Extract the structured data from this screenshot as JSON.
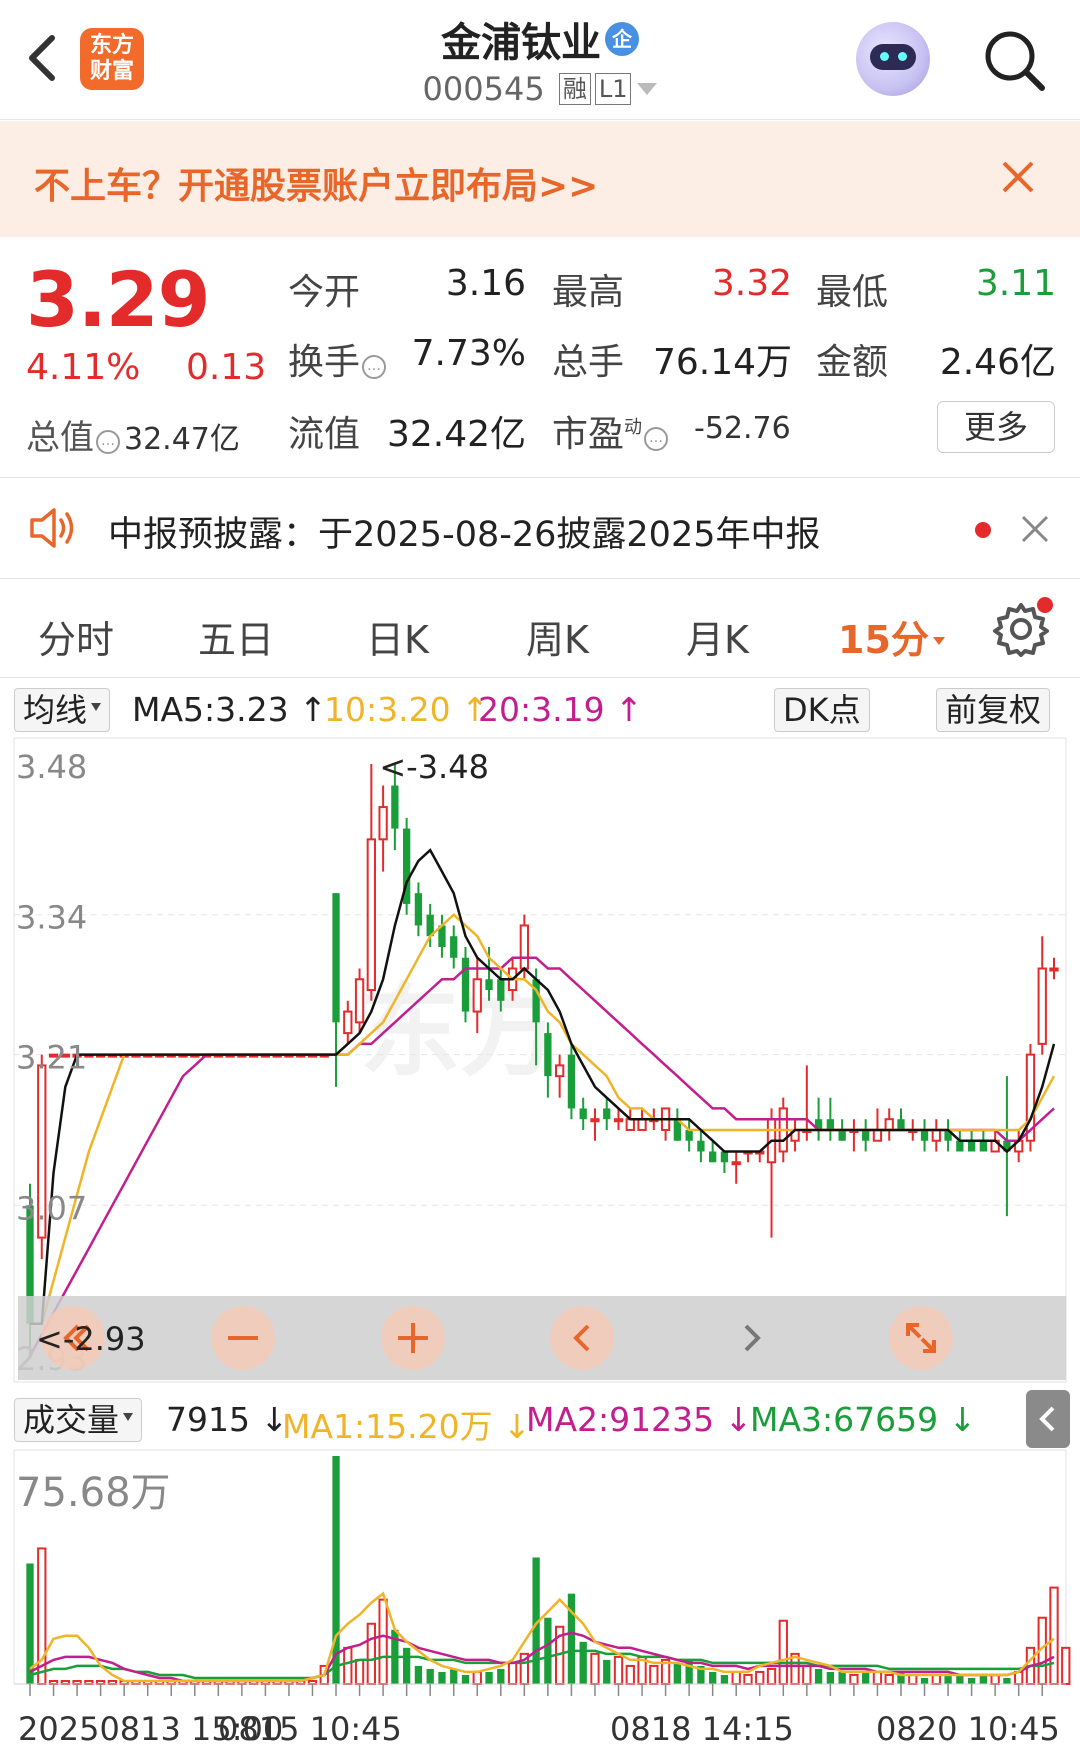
{
  "header": {
    "title": "金浦钛业",
    "qi_badge": "企",
    "code": "000545",
    "tag_rong": "融",
    "tag_level": "L1",
    "logo_text_line1": "东方",
    "logo_text_line2": "财富"
  },
  "banner": {
    "text": "不上车？开通股票账户立即布局>>"
  },
  "quote": {
    "price": "3.29",
    "change_pct": "4.11%",
    "change": "0.13",
    "total_value_label": "总值",
    "total_value": "32.47亿",
    "open_label": "今开",
    "open": "3.16",
    "high_label": "最高",
    "high": "3.32",
    "low_label": "最低",
    "low": "3.11",
    "turnover_label": "换手",
    "turnover": "7.73%",
    "volume_label": "总手",
    "volume": "76.14万",
    "amount_label": "金额",
    "amount": "2.46亿",
    "float_label": "流值",
    "float_value": "32.42亿",
    "pe_label": "市盈",
    "pe_sup": "动",
    "pe": "-52.76",
    "more_button": "更多"
  },
  "notice": {
    "text": "中报预披露：于2025-08-26披露2025年中报"
  },
  "tabs": {
    "items": [
      "分时",
      "五日",
      "日K",
      "周K",
      "月K",
      "15分"
    ],
    "active_index": 5
  },
  "ma_row": {
    "selector": "均线",
    "ma5": "MA5:3.23 ↑",
    "ma10": "10:3.20 ↑",
    "ma20": "20:3.19 ↑",
    "dk_button": "DK点",
    "fq_button": "前复权"
  },
  "vol_row": {
    "selector": "成交量",
    "vol": "7915 ↓",
    "ma1": "MA1:15.20万 ↓",
    "ma2": "MA2:91235 ↓",
    "ma3": "MA3:67659 ↓"
  },
  "colors": {
    "up": "#e42b2b",
    "down": "#1a9e3a",
    "accent": "#e8662a",
    "ma5": "#111111",
    "ma10": "#f0b429",
    "ma20": "#c21e8e"
  },
  "chart_data": [
    {
      "type": "candlestick",
      "y_ticks": [
        "3.48",
        "3.34",
        "3.21",
        "3.07",
        "2.93"
      ],
      "ylim": [
        2.93,
        3.48
      ],
      "max_marker": "<-3.48",
      "min_marker": "<-2.93",
      "x_labels": [
        "20250813 15:00",
        "0815 10:45",
        "0818 14:15",
        "0820 10:45"
      ],
      "candles": [
        {
          "o": 3.07,
          "c": 2.96,
          "h": 3.09,
          "l": 2.93
        },
        {
          "o": 3.04,
          "c": 3.2,
          "h": 3.21,
          "l": 3.02
        },
        {
          "o": 3.21,
          "c": 3.21,
          "h": 3.21,
          "l": 3.21
        },
        {
          "o": 3.21,
          "c": 3.21,
          "h": 3.21,
          "l": 3.21
        },
        {
          "o": 3.21,
          "c": 3.21,
          "h": 3.21,
          "l": 3.21
        },
        {
          "o": 3.21,
          "c": 3.21,
          "h": 3.21,
          "l": 3.21
        },
        {
          "o": 3.21,
          "c": 3.21,
          "h": 3.21,
          "l": 3.21
        },
        {
          "o": 3.21,
          "c": 3.21,
          "h": 3.21,
          "l": 3.21
        },
        {
          "o": 3.21,
          "c": 3.21,
          "h": 3.21,
          "l": 3.21
        },
        {
          "o": 3.21,
          "c": 3.21,
          "h": 3.21,
          "l": 3.21
        },
        {
          "o": 3.21,
          "c": 3.21,
          "h": 3.21,
          "l": 3.21
        },
        {
          "o": 3.21,
          "c": 3.21,
          "h": 3.21,
          "l": 3.21
        },
        {
          "o": 3.21,
          "c": 3.21,
          "h": 3.21,
          "l": 3.21
        },
        {
          "o": 3.21,
          "c": 3.21,
          "h": 3.21,
          "l": 3.21
        },
        {
          "o": 3.21,
          "c": 3.21,
          "h": 3.21,
          "l": 3.21
        },
        {
          "o": 3.21,
          "c": 3.21,
          "h": 3.21,
          "l": 3.21
        },
        {
          "o": 3.21,
          "c": 3.21,
          "h": 3.21,
          "l": 3.21
        },
        {
          "o": 3.21,
          "c": 3.21,
          "h": 3.21,
          "l": 3.21
        },
        {
          "o": 3.21,
          "c": 3.21,
          "h": 3.21,
          "l": 3.21
        },
        {
          "o": 3.21,
          "c": 3.21,
          "h": 3.21,
          "l": 3.21
        },
        {
          "o": 3.21,
          "c": 3.21,
          "h": 3.21,
          "l": 3.21
        },
        {
          "o": 3.21,
          "c": 3.21,
          "h": 3.21,
          "l": 3.21
        },
        {
          "o": 3.21,
          "c": 3.21,
          "h": 3.21,
          "l": 3.21
        },
        {
          "o": 3.21,
          "c": 3.21,
          "h": 3.21,
          "l": 3.21
        },
        {
          "o": 3.21,
          "c": 3.21,
          "h": 3.21,
          "l": 3.21
        },
        {
          "o": 3.21,
          "c": 3.21,
          "h": 3.21,
          "l": 3.21
        },
        {
          "o": 3.36,
          "c": 3.24,
          "h": 3.36,
          "l": 3.18
        },
        {
          "o": 3.23,
          "c": 3.25,
          "h": 3.26,
          "l": 3.22
        },
        {
          "o": 3.24,
          "c": 3.28,
          "h": 3.29,
          "l": 3.23
        },
        {
          "o": 3.27,
          "c": 3.41,
          "h": 3.48,
          "l": 3.26
        },
        {
          "o": 3.41,
          "c": 3.44,
          "h": 3.46,
          "l": 3.38
        },
        {
          "o": 3.46,
          "c": 3.42,
          "h": 3.48,
          "l": 3.4
        },
        {
          "o": 3.42,
          "c": 3.35,
          "h": 3.43,
          "l": 3.34
        },
        {
          "o": 3.36,
          "c": 3.33,
          "h": 3.37,
          "l": 3.32
        },
        {
          "o": 3.34,
          "c": 3.32,
          "h": 3.35,
          "l": 3.31
        },
        {
          "o": 3.33,
          "c": 3.31,
          "h": 3.34,
          "l": 3.3
        },
        {
          "o": 3.32,
          "c": 3.3,
          "h": 3.33,
          "l": 3.29
        },
        {
          "o": 3.3,
          "c": 3.25,
          "h": 3.31,
          "l": 3.24
        },
        {
          "o": 3.25,
          "c": 3.28,
          "h": 3.3,
          "l": 3.23
        },
        {
          "o": 3.28,
          "c": 3.27,
          "h": 3.31,
          "l": 3.26
        },
        {
          "o": 3.28,
          "c": 3.26,
          "h": 3.29,
          "l": 3.25
        },
        {
          "o": 3.27,
          "c": 3.29,
          "h": 3.3,
          "l": 3.26
        },
        {
          "o": 3.29,
          "c": 3.33,
          "h": 3.34,
          "l": 3.28
        },
        {
          "o": 3.28,
          "c": 3.24,
          "h": 3.29,
          "l": 3.2
        },
        {
          "o": 3.23,
          "c": 3.19,
          "h": 3.24,
          "l": 3.17
        },
        {
          "o": 3.19,
          "c": 3.2,
          "h": 3.21,
          "l": 3.17
        },
        {
          "o": 3.21,
          "c": 3.16,
          "h": 3.22,
          "l": 3.15
        },
        {
          "o": 3.16,
          "c": 3.15,
          "h": 3.17,
          "l": 3.14
        },
        {
          "o": 3.15,
          "c": 3.15,
          "h": 3.16,
          "l": 3.13
        },
        {
          "o": 3.16,
          "c": 3.15,
          "h": 3.17,
          "l": 3.14
        },
        {
          "o": 3.15,
          "c": 3.15,
          "h": 3.16,
          "l": 3.14
        },
        {
          "o": 3.14,
          "c": 3.15,
          "h": 3.16,
          "l": 3.14
        },
        {
          "o": 3.14,
          "c": 3.15,
          "h": 3.16,
          "l": 3.14
        },
        {
          "o": 3.15,
          "c": 3.15,
          "h": 3.16,
          "l": 3.14
        },
        {
          "o": 3.14,
          "c": 3.16,
          "h": 3.16,
          "l": 3.13
        },
        {
          "o": 3.15,
          "c": 3.13,
          "h": 3.16,
          "l": 3.13
        },
        {
          "o": 3.14,
          "c": 3.13,
          "h": 3.15,
          "l": 3.12
        },
        {
          "o": 3.13,
          "c": 3.12,
          "h": 3.14,
          "l": 3.11
        },
        {
          "o": 3.12,
          "c": 3.11,
          "h": 3.13,
          "l": 3.11
        },
        {
          "o": 3.12,
          "c": 3.11,
          "h": 3.12,
          "l": 3.1
        },
        {
          "o": 3.11,
          "c": 3.11,
          "h": 3.12,
          "l": 3.09
        },
        {
          "o": 3.12,
          "c": 3.12,
          "h": 3.12,
          "l": 3.11
        },
        {
          "o": 3.12,
          "c": 3.12,
          "h": 3.12,
          "l": 3.11
        },
        {
          "o": 3.11,
          "c": 3.15,
          "h": 3.16,
          "l": 3.04
        },
        {
          "o": 3.12,
          "c": 3.16,
          "h": 3.17,
          "l": 3.11
        },
        {
          "o": 3.13,
          "c": 3.14,
          "h": 3.15,
          "l": 3.12
        },
        {
          "o": 3.14,
          "c": 3.14,
          "h": 3.2,
          "l": 3.13
        },
        {
          "o": 3.15,
          "c": 3.14,
          "h": 3.17,
          "l": 3.13
        },
        {
          "o": 3.15,
          "c": 3.14,
          "h": 3.17,
          "l": 3.13
        },
        {
          "o": 3.14,
          "c": 3.13,
          "h": 3.15,
          "l": 3.13
        },
        {
          "o": 3.14,
          "c": 3.14,
          "h": 3.15,
          "l": 3.12
        },
        {
          "o": 3.14,
          "c": 3.13,
          "h": 3.15,
          "l": 3.12
        },
        {
          "o": 3.13,
          "c": 3.14,
          "h": 3.16,
          "l": 3.13
        },
        {
          "o": 3.14,
          "c": 3.15,
          "h": 3.16,
          "l": 3.13
        },
        {
          "o": 3.15,
          "c": 3.14,
          "h": 3.16,
          "l": 3.14
        },
        {
          "o": 3.14,
          "c": 3.14,
          "h": 3.15,
          "l": 3.13
        },
        {
          "o": 3.14,
          "c": 3.13,
          "h": 3.15,
          "l": 3.12
        },
        {
          "o": 3.13,
          "c": 3.14,
          "h": 3.15,
          "l": 3.12
        },
        {
          "o": 3.14,
          "c": 3.13,
          "h": 3.15,
          "l": 3.12
        },
        {
          "o": 3.13,
          "c": 3.12,
          "h": 3.14,
          "l": 3.12
        },
        {
          "o": 3.13,
          "c": 3.12,
          "h": 3.14,
          "l": 3.12
        },
        {
          "o": 3.13,
          "c": 3.12,
          "h": 3.14,
          "l": 3.12
        },
        {
          "o": 3.12,
          "c": 3.13,
          "h": 3.14,
          "l": 3.12
        },
        {
          "o": 3.13,
          "c": 3.12,
          "h": 3.19,
          "l": 3.06
        },
        {
          "o": 3.12,
          "c": 3.13,
          "h": 3.14,
          "l": 3.11
        },
        {
          "o": 3.13,
          "c": 3.21,
          "h": 3.22,
          "l": 3.12
        },
        {
          "o": 3.22,
          "c": 3.29,
          "h": 3.32,
          "l": 3.21
        },
        {
          "o": 3.29,
          "c": 3.29,
          "h": 3.3,
          "l": 3.28
        }
      ],
      "ma5": [
        2.96,
        2.96,
        3.1,
        3.18,
        3.21,
        3.21,
        3.21,
        3.21,
        3.21,
        3.21,
        3.21,
        3.21,
        3.21,
        3.21,
        3.21,
        3.21,
        3.21,
        3.21,
        3.21,
        3.21,
        3.21,
        3.21,
        3.21,
        3.21,
        3.21,
        3.21,
        3.21,
        3.22,
        3.23,
        3.25,
        3.28,
        3.33,
        3.37,
        3.39,
        3.4,
        3.38,
        3.36,
        3.32,
        3.3,
        3.29,
        3.28,
        3.28,
        3.29,
        3.28,
        3.27,
        3.25,
        3.22,
        3.2,
        3.18,
        3.17,
        3.16,
        3.15,
        3.15,
        3.15,
        3.15,
        3.15,
        3.15,
        3.14,
        3.13,
        3.12,
        3.12,
        3.12,
        3.12,
        3.13,
        3.13,
        3.14,
        3.14,
        3.14,
        3.14,
        3.14,
        3.14,
        3.14,
        3.14,
        3.14,
        3.14,
        3.14,
        3.14,
        3.14,
        3.14,
        3.13,
        3.13,
        3.13,
        3.13,
        3.12,
        3.13,
        3.15,
        3.18,
        3.22
      ],
      "ma10": [
        2.96,
        2.96,
        3.0,
        3.04,
        3.08,
        3.12,
        3.15,
        3.18,
        3.21,
        3.21,
        3.21,
        3.21,
        3.21,
        3.21,
        3.21,
        3.21,
        3.21,
        3.21,
        3.21,
        3.21,
        3.21,
        3.21,
        3.21,
        3.21,
        3.21,
        3.21,
        3.21,
        3.21,
        3.22,
        3.23,
        3.24,
        3.26,
        3.28,
        3.3,
        3.32,
        3.33,
        3.34,
        3.33,
        3.32,
        3.3,
        3.29,
        3.28,
        3.28,
        3.27,
        3.25,
        3.24,
        3.22,
        3.21,
        3.2,
        3.19,
        3.17,
        3.16,
        3.16,
        3.15,
        3.15,
        3.15,
        3.14,
        3.14,
        3.14,
        3.14,
        3.14,
        3.14,
        3.14,
        3.14,
        3.14,
        3.14,
        3.14,
        3.14,
        3.14,
        3.14,
        3.14,
        3.14,
        3.14,
        3.14,
        3.14,
        3.14,
        3.14,
        3.14,
        3.14,
        3.14,
        3.14,
        3.14,
        3.14,
        3.14,
        3.14,
        3.15,
        3.17,
        3.19
      ],
      "ma20": [
        2.93,
        2.95,
        2.97,
        2.99,
        3.01,
        3.03,
        3.05,
        3.07,
        3.09,
        3.11,
        3.13,
        3.15,
        3.17,
        3.19,
        3.2,
        3.21,
        3.21,
        3.21,
        3.21,
        3.21,
        3.21,
        3.21,
        3.21,
        3.21,
        3.21,
        3.21,
        3.21,
        3.21,
        3.22,
        3.22,
        3.23,
        3.24,
        3.25,
        3.26,
        3.27,
        3.28,
        3.28,
        3.29,
        3.29,
        3.29,
        3.29,
        3.3,
        3.3,
        3.3,
        3.29,
        3.29,
        3.28,
        3.27,
        3.26,
        3.25,
        3.24,
        3.23,
        3.22,
        3.21,
        3.2,
        3.19,
        3.18,
        3.17,
        3.16,
        3.16,
        3.15,
        3.15,
        3.15,
        3.15,
        3.15,
        3.15,
        3.15,
        3.14,
        3.14,
        3.14,
        3.14,
        3.14,
        3.14,
        3.14,
        3.14,
        3.14,
        3.14,
        3.14,
        3.14,
        3.14,
        3.14,
        3.14,
        3.14,
        3.13,
        3.13,
        3.14,
        3.15,
        3.16
      ]
    },
    {
      "type": "bar",
      "y_label": "75.68万",
      "ymax": 75.68,
      "unit": "万",
      "volumes": [
        40,
        45,
        1,
        1,
        1,
        1,
        1,
        1,
        1,
        1,
        1,
        1,
        1,
        1,
        1,
        1,
        1,
        1,
        1,
        1,
        1,
        1,
        1,
        1,
        1,
        6,
        75.68,
        12,
        8,
        20,
        28,
        18,
        12,
        6,
        5,
        4,
        5,
        3,
        4,
        4,
        5,
        7,
        10,
        42,
        22,
        19,
        30,
        14,
        10,
        8,
        9,
        6,
        9,
        6,
        8,
        7,
        8,
        6,
        4,
        3,
        4,
        3,
        4,
        5,
        21,
        10,
        6,
        5,
        4,
        4,
        3,
        4,
        4,
        3,
        4,
        3,
        2,
        3,
        3,
        3,
        2,
        3,
        3,
        2,
        4,
        12,
        22,
        32,
        12
      ],
      "ma1": [
        5,
        8,
        15,
        16,
        16,
        12,
        6,
        3,
        1,
        1,
        1,
        1,
        1,
        1,
        1,
        1,
        1,
        1,
        1,
        1,
        1,
        1,
        1,
        1,
        2,
        3,
        16,
        20,
        23,
        27,
        30,
        18,
        14,
        11,
        8,
        6,
        5,
        4,
        4,
        5,
        6,
        8,
        14,
        20,
        24,
        28,
        24,
        20,
        14,
        12,
        10,
        8,
        8,
        7,
        7,
        7,
        6,
        5,
        5,
        4,
        4,
        4,
        6,
        7,
        8,
        9,
        8,
        7,
        6,
        4,
        4,
        4,
        4,
        4,
        3,
        3,
        3,
        3,
        3,
        3,
        3,
        3,
        3,
        3,
        4,
        8,
        12,
        15
      ],
      "ma2": [
        4,
        6,
        8,
        9,
        9,
        9,
        8,
        7,
        5,
        4,
        3,
        2,
        2,
        1,
        1,
        1,
        1,
        1,
        1,
        1,
        1,
        1,
        1,
        1,
        2,
        3,
        10,
        12,
        13,
        15,
        16,
        15,
        14,
        12,
        11,
        10,
        9,
        8,
        8,
        8,
        7,
        7,
        8,
        11,
        13,
        16,
        17,
        16,
        14,
        13,
        12,
        12,
        11,
        10,
        9,
        8,
        7,
        7,
        6,
        6,
        6,
        5,
        6,
        6,
        6,
        6,
        6,
        6,
        5,
        5,
        5,
        5,
        4,
        4,
        4,
        4,
        4,
        4,
        4,
        3,
        3,
        3,
        3,
        3,
        4,
        6,
        7,
        9
      ],
      "ma3": [
        3,
        4,
        5,
        5,
        6,
        6,
        6,
        5,
        5,
        4,
        4,
        3,
        3,
        3,
        2,
        2,
        2,
        2,
        2,
        2,
        2,
        2,
        2,
        2,
        2,
        3,
        6,
        7,
        8,
        8,
        9,
        9,
        9,
        9,
        8,
        8,
        8,
        7,
        7,
        7,
        7,
        7,
        7,
        8,
        9,
        10,
        11,
        11,
        11,
        10,
        10,
        10,
        9,
        9,
        9,
        8,
        8,
        8,
        7,
        7,
        7,
        7,
        7,
        7,
        7,
        7,
        7,
        6,
        6,
        6,
        6,
        6,
        6,
        5,
        5,
        5,
        5,
        5,
        5,
        5,
        5,
        5,
        5,
        5,
        5,
        6,
        6,
        7
      ]
    }
  ]
}
